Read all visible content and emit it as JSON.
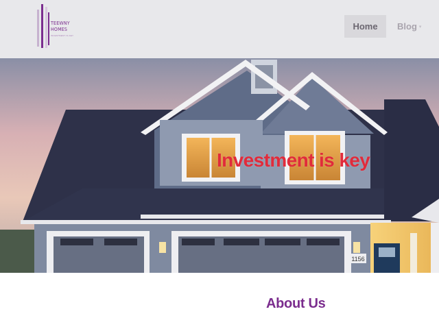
{
  "header": {
    "logo": {
      "line1": "TEEWNY",
      "line2": "HOMES",
      "tagline": "INVESTMENT IS KEY"
    },
    "nav": {
      "home_label": "Home",
      "blog_label": "Blog",
      "blog_caret": "▾"
    }
  },
  "hero": {
    "title": "Investment is key",
    "house_number": "1156"
  },
  "about": {
    "title": "About Us"
  },
  "colors": {
    "brand_purple": "#7b2d8e",
    "hero_title_red": "#e12b3b",
    "header_bg": "#e8e8eb"
  }
}
